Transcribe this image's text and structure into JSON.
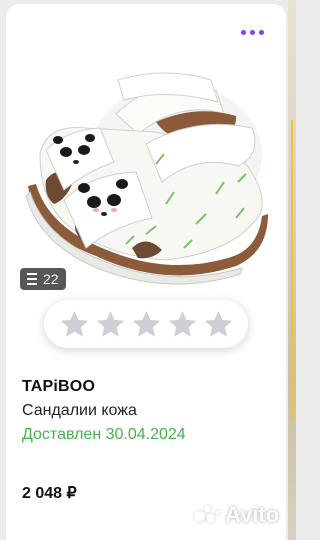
{
  "listing": {
    "photo_count": "22",
    "brand": "TAPiBOO",
    "title": "Сандалии кожа",
    "status": "Доставлен 30.04.2024",
    "price": "2 048 ₽"
  },
  "rating": {
    "max_stars": 5,
    "value": 0
  },
  "watermark": "Avito",
  "colors": {
    "accent": "#8a3cf0",
    "status_green": "#46b34a",
    "star_empty": "#cfcdd6"
  },
  "icons": [
    "more-icon",
    "gallery-icon",
    "star-icon"
  ]
}
